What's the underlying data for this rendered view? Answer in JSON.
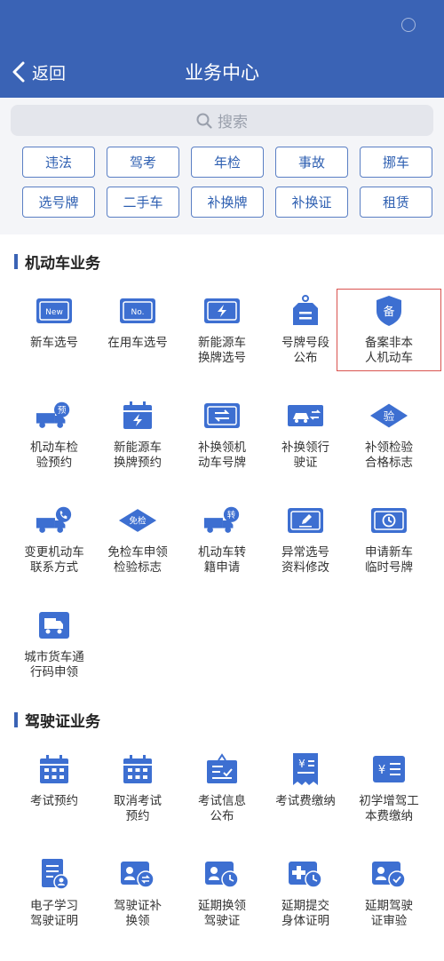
{
  "header": {
    "back_label": "返回",
    "title": "业务中心"
  },
  "search": {
    "placeholder": "搜索"
  },
  "quick_tags": [
    "违法",
    "驾考",
    "年检",
    "事故",
    "挪车",
    "选号牌",
    "二手车",
    "补换牌",
    "补换证",
    "租赁"
  ],
  "sections": [
    {
      "title": "机动车业务",
      "items": [
        {
          "lines": [
            "新车选号"
          ],
          "icon": "new-plate-icon"
        },
        {
          "lines": [
            "在用车选号"
          ],
          "icon": "no-plate-icon"
        },
        {
          "lines": [
            "新能源车",
            "换牌选号"
          ],
          "icon": "ev-plate-icon"
        },
        {
          "lines": [
            "号牌号段",
            "公布"
          ],
          "icon": "plate-tag-icon"
        },
        {
          "lines": [
            "备案非本",
            "人机动车"
          ],
          "icon": "filing-shield-icon"
        },
        {
          "lines": [
            "机动车检",
            "验预约"
          ],
          "icon": "truck-inspect-icon"
        },
        {
          "lines": [
            "新能源车",
            "换牌预约"
          ],
          "icon": "ev-calendar-icon"
        },
        {
          "lines": [
            "补换领机",
            "动车号牌"
          ],
          "icon": "plate-swap-icon"
        },
        {
          "lines": [
            "补换领行",
            "驶证"
          ],
          "icon": "car-swap-icon"
        },
        {
          "lines": [
            "补领检验",
            "合格标志"
          ],
          "icon": "inspection-diamond-icon"
        },
        {
          "lines": [
            "变更机动车",
            "联系方式"
          ],
          "icon": "truck-phone-icon"
        },
        {
          "lines": [
            "免检车申领",
            "检验标志"
          ],
          "icon": "exempt-diamond-icon"
        },
        {
          "lines": [
            "机动车转",
            "籍申请"
          ],
          "icon": "truck-transfer-icon"
        },
        {
          "lines": [
            "异常选号",
            "资料修改"
          ],
          "icon": "plate-edit-icon"
        },
        {
          "lines": [
            "申请新车",
            "临时号牌"
          ],
          "icon": "temp-plate-icon"
        },
        {
          "lines": [
            "城市货车通",
            "行码申领"
          ],
          "icon": "cargo-truck-icon"
        }
      ]
    },
    {
      "title": "驾驶证业务",
      "items": [
        {
          "lines": [
            "考试预约"
          ],
          "icon": "calendar-icon"
        },
        {
          "lines": [
            "取消考试",
            "预约"
          ],
          "icon": "calendar-cancel-icon"
        },
        {
          "lines": [
            "考试信息",
            "公布"
          ],
          "icon": "notice-board-icon"
        },
        {
          "lines": [
            "考试费缴纳"
          ],
          "icon": "fee-receipt-icon"
        },
        {
          "lines": [
            "初学增驾工",
            "本费缴纳"
          ],
          "icon": "fee-list-icon"
        },
        {
          "lines": [
            "电子学习",
            "驾驶证明"
          ],
          "icon": "e-learning-doc-icon"
        },
        {
          "lines": [
            "驾驶证补",
            "换领"
          ],
          "icon": "license-swap-icon"
        },
        {
          "lines": [
            "延期换领",
            "驾驶证"
          ],
          "icon": "license-clock-icon"
        },
        {
          "lines": [
            "延期提交",
            "身体证明"
          ],
          "icon": "medical-clock-icon"
        },
        {
          "lines": [
            "延期驾驶",
            "证审验"
          ],
          "icon": "license-check-icon"
        }
      ]
    }
  ],
  "highlight_item": "备案非本人机动车",
  "colors": {
    "header": "#3a63b5",
    "accent": "#2e5fb1",
    "icon_blue": "#3d6fd1",
    "highlight": "#d9534f"
  }
}
